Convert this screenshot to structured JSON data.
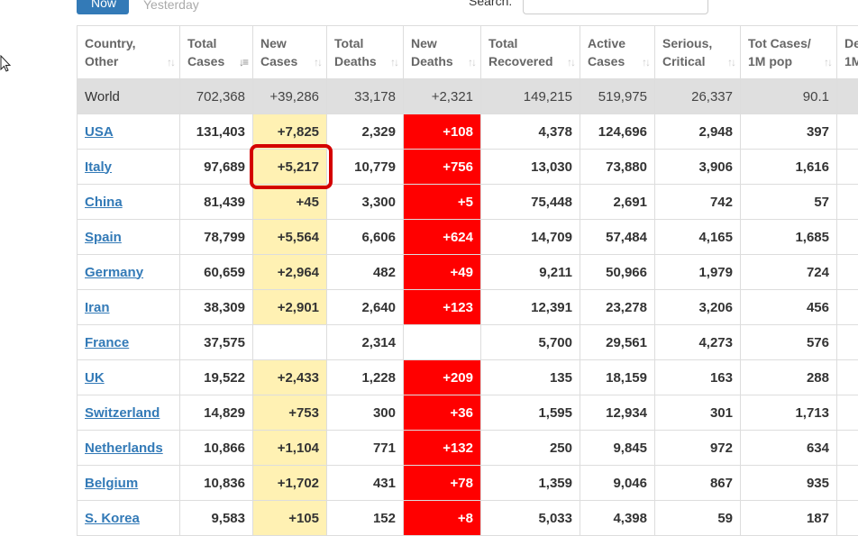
{
  "tabs": {
    "now": "Now",
    "yesterday": "Yesterday"
  },
  "search": {
    "label": "Search:",
    "value": ""
  },
  "colors": {
    "new_cases_bg": "#fff1b3",
    "new_deaths_bg": "#ff0000",
    "world_row_bg": "#dfdfdf",
    "link": "#337ab7",
    "highlight": "#d40000"
  },
  "table": {
    "headers": [
      {
        "line1": "Country,",
        "line2": "Other"
      },
      {
        "line1": "Total",
        "line2": "Cases"
      },
      {
        "line1": "New",
        "line2": "Cases"
      },
      {
        "line1": "Total",
        "line2": "Deaths"
      },
      {
        "line1": "New",
        "line2": "Deaths"
      },
      {
        "line1": "Total",
        "line2": "Recovered"
      },
      {
        "line1": "Active",
        "line2": "Cases"
      },
      {
        "line1": "Serious,",
        "line2": "Critical"
      },
      {
        "line1": "Tot Cases/",
        "line2": "1M pop"
      },
      {
        "line1": "De",
        "line2": "1M"
      }
    ],
    "rows": [
      {
        "country": "World",
        "total_cases": "702,368",
        "new_cases": "+39,286",
        "total_deaths": "33,178",
        "new_deaths": "+2,321",
        "total_recovered": "149,215",
        "active_cases": "519,975",
        "serious_critical": "26,337",
        "cases_per_1m": "90.1"
      },
      {
        "country": "USA",
        "total_cases": "131,403",
        "new_cases": "+7,825",
        "total_deaths": "2,329",
        "new_deaths": "+108",
        "total_recovered": "4,378",
        "active_cases": "124,696",
        "serious_critical": "2,948",
        "cases_per_1m": "397"
      },
      {
        "country": "Italy",
        "total_cases": "97,689",
        "new_cases": "+5,217",
        "total_deaths": "10,779",
        "new_deaths": "+756",
        "total_recovered": "13,030",
        "active_cases": "73,880",
        "serious_critical": "3,906",
        "cases_per_1m": "1,616"
      },
      {
        "country": "China",
        "total_cases": "81,439",
        "new_cases": "+45",
        "total_deaths": "3,300",
        "new_deaths": "+5",
        "total_recovered": "75,448",
        "active_cases": "2,691",
        "serious_critical": "742",
        "cases_per_1m": "57"
      },
      {
        "country": "Spain",
        "total_cases": "78,799",
        "new_cases": "+5,564",
        "total_deaths": "6,606",
        "new_deaths": "+624",
        "total_recovered": "14,709",
        "active_cases": "57,484",
        "serious_critical": "4,165",
        "cases_per_1m": "1,685"
      },
      {
        "country": "Germany",
        "total_cases": "60,659",
        "new_cases": "+2,964",
        "total_deaths": "482",
        "new_deaths": "+49",
        "total_recovered": "9,211",
        "active_cases": "50,966",
        "serious_critical": "1,979",
        "cases_per_1m": "724"
      },
      {
        "country": "Iran",
        "total_cases": "38,309",
        "new_cases": "+2,901",
        "total_deaths": "2,640",
        "new_deaths": "+123",
        "total_recovered": "12,391",
        "active_cases": "23,278",
        "serious_critical": "3,206",
        "cases_per_1m": "456"
      },
      {
        "country": "France",
        "total_cases": "37,575",
        "new_cases": "",
        "total_deaths": "2,314",
        "new_deaths": "",
        "total_recovered": "5,700",
        "active_cases": "29,561",
        "serious_critical": "4,273",
        "cases_per_1m": "576"
      },
      {
        "country": "UK",
        "total_cases": "19,522",
        "new_cases": "+2,433",
        "total_deaths": "1,228",
        "new_deaths": "+209",
        "total_recovered": "135",
        "active_cases": "18,159",
        "serious_critical": "163",
        "cases_per_1m": "288"
      },
      {
        "country": "Switzerland",
        "total_cases": "14,829",
        "new_cases": "+753",
        "total_deaths": "300",
        "new_deaths": "+36",
        "total_recovered": "1,595",
        "active_cases": "12,934",
        "serious_critical": "301",
        "cases_per_1m": "1,713"
      },
      {
        "country": "Netherlands",
        "total_cases": "10,866",
        "new_cases": "+1,104",
        "total_deaths": "771",
        "new_deaths": "+132",
        "total_recovered": "250",
        "active_cases": "9,845",
        "serious_critical": "972",
        "cases_per_1m": "634"
      },
      {
        "country": "Belgium",
        "total_cases": "10,836",
        "new_cases": "+1,702",
        "total_deaths": "431",
        "new_deaths": "+78",
        "total_recovered": "1,359",
        "active_cases": "9,046",
        "serious_critical": "867",
        "cases_per_1m": "935"
      },
      {
        "country": "S. Korea",
        "total_cases": "9,583",
        "new_cases": "+105",
        "total_deaths": "152",
        "new_deaths": "+8",
        "total_recovered": "5,033",
        "active_cases": "4,398",
        "serious_critical": "59",
        "cases_per_1m": "187"
      }
    ]
  }
}
